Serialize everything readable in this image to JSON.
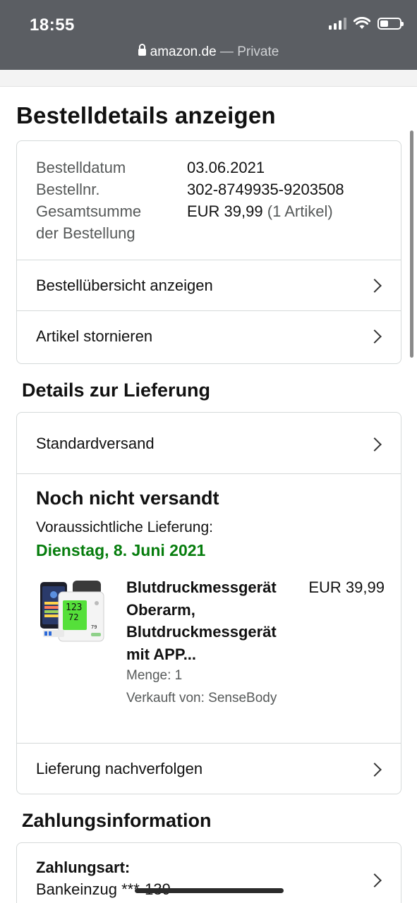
{
  "status_bar": {
    "time": "18:55",
    "url": "amazon.de",
    "url_suffix": " — Private"
  },
  "page": {
    "title": "Bestelldetails anzeigen"
  },
  "order_summary": {
    "date_label": "Bestelldatum",
    "date_value": "03.06.2021",
    "number_label": "Bestellnr.",
    "number_value": "302-8749935-9203508",
    "total_label_line1": "Gesamtsumme",
    "total_label_line2": "der Bestellung",
    "total_value": "EUR 39,99",
    "total_items": "(1 Artikel)",
    "links": [
      {
        "label": "Bestellübersicht anzeigen"
      },
      {
        "label": "Artikel stornieren"
      }
    ]
  },
  "delivery": {
    "section_title": "Details zur Lieferung",
    "shipping_method": "Standardversand",
    "status": "Noch nicht versandt",
    "eta_label": "Voraussichtliche Lieferung:",
    "eta_date": "Dienstag, 8. Juni 2021",
    "product": {
      "title_lines": [
        "Blutdruckmessgerät",
        "Oberarm,",
        "Blutdruckmessgerät",
        "mit APP..."
      ],
      "price": "EUR 39,99",
      "quantity": "Menge: 1",
      "seller": "Verkauft von: SenseBody",
      "image_icon": "blood-pressure-monitor-image"
    },
    "track_label": "Lieferung nachverfolgen"
  },
  "payment": {
    "section_title": "Zahlungsinformation",
    "method_label": "Zahlungsart:",
    "method_value": "Bankeinzug ***-139"
  },
  "colors": {
    "topbar": "#5b5e63",
    "eta_green": "#067d0d",
    "border": "#d5d9d9",
    "muted_text": "#565959"
  }
}
